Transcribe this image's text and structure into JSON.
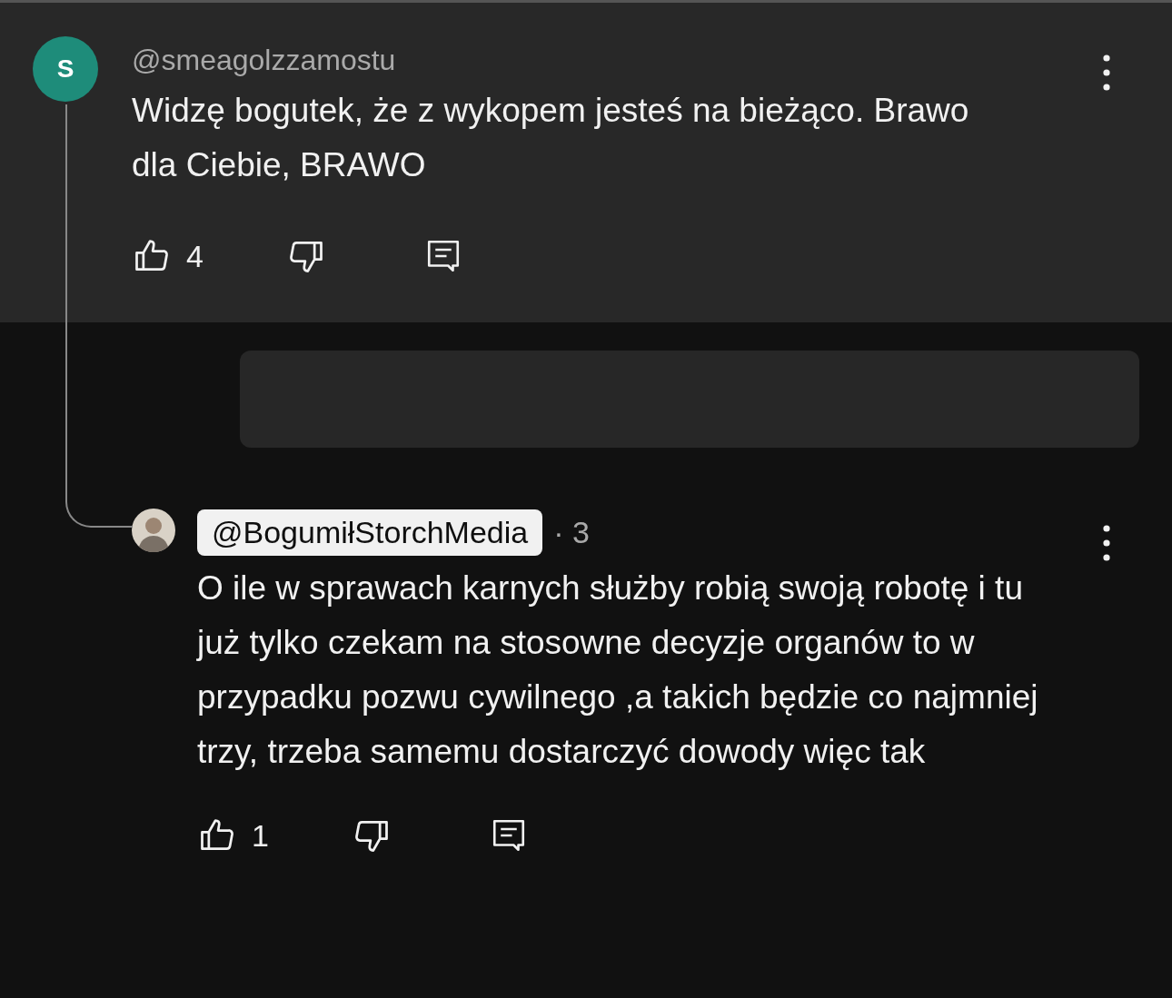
{
  "comment": {
    "author": "@smeagolzzamostu",
    "avatar_letter": "S",
    "color": "#1e8c7a",
    "text": "Widzę bogutek, że z wykopem jesteś na bieżąco. Brawo dla Ciebie, BRAWO",
    "likes": "4"
  },
  "reply": {
    "author": "@BogumiłStorchMedia",
    "author_highlighted": true,
    "time": "· 3",
    "text": "O ile w sprawach karnych służby robią swoją robotę i tu już tylko czekam na stosowne decyzje organów to w przypadku pozwu cywilnego ,a takich będzie co najmniej trzy, trzeba samemu dostarczyć dowody więc tak",
    "likes": "1"
  }
}
